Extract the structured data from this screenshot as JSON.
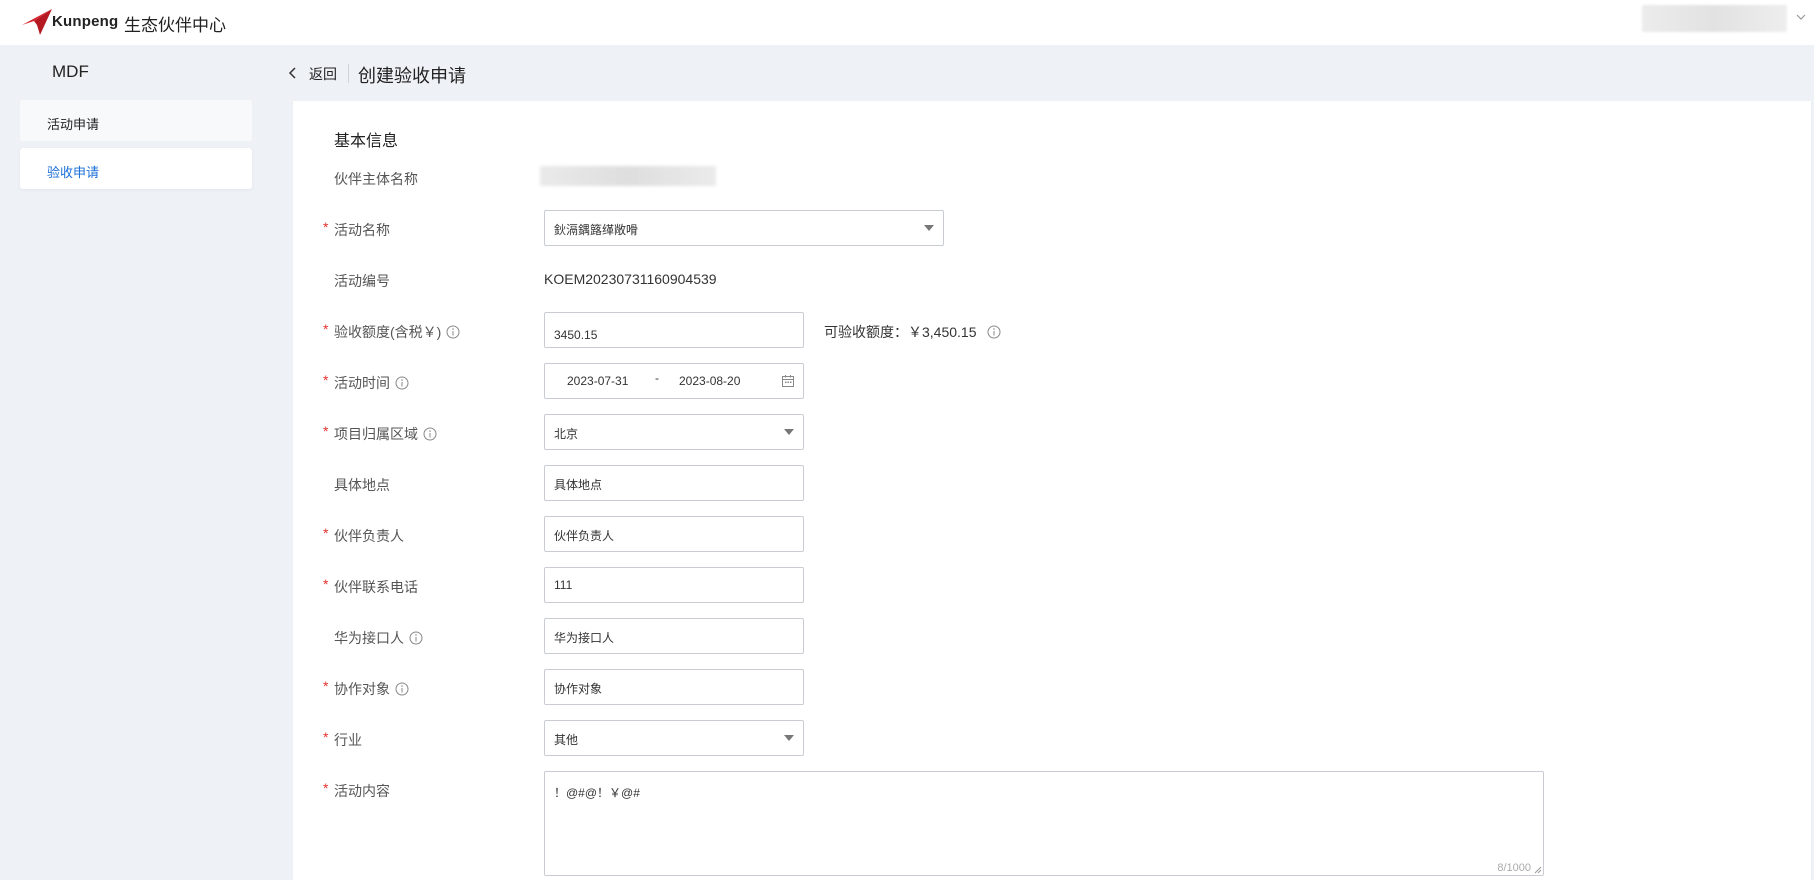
{
  "header": {
    "brand": "Kunpeng",
    "portal_title": "生态伙伴中心"
  },
  "sidebar": {
    "title": "MDF",
    "items": [
      {
        "label": "活动申请",
        "active": false
      },
      {
        "label": "验收申请",
        "active": true
      }
    ]
  },
  "breadcrumb": {
    "back_label": "返回",
    "page_title": "创建验收申请"
  },
  "form": {
    "section_title": "基本信息",
    "partner_name": {
      "label": "伙伴主体名称"
    },
    "activity_name": {
      "label": "活动名称",
      "value": "鈥滆鍝簬缂敞嗗",
      "required": true
    },
    "activity_no": {
      "label": "活动编号",
      "value": "KOEM20230731160904539"
    },
    "amount": {
      "label": "验收额度(含税￥)",
      "value": "3450.15",
      "required": true,
      "available_label": "可验收额度：￥3,450.15"
    },
    "activity_time": {
      "label": "活动时间",
      "from": "2023-07-31",
      "separator": "-",
      "to": "2023-08-20",
      "required": true
    },
    "region": {
      "label": "项目归属区域",
      "value": "北京",
      "required": true
    },
    "location": {
      "label": "具体地点",
      "value": "具体地点"
    },
    "partner_owner": {
      "label": "伙伴负责人",
      "value": "伙伴负责人",
      "required": true
    },
    "partner_phone": {
      "label": "伙伴联系电话",
      "value": "111",
      "required": true
    },
    "huawei_contact": {
      "label": "华为接口人",
      "value": "华为接口人"
    },
    "collab_target": {
      "label": "协作对象",
      "value": "协作对象",
      "required": true
    },
    "industry": {
      "label": "行业",
      "value": "其他",
      "required": true
    },
    "content": {
      "label": "活动内容",
      "value": "！@#@！￥@#",
      "counter": "8/1000",
      "required": true
    }
  },
  "colors": {
    "accent": "#1a6ed8",
    "required": "#e0312f",
    "brand_red": "#d7202a"
  },
  "icons": [
    "kunpeng-logo",
    "chevron-down-icon",
    "chevron-left-icon",
    "info-icon",
    "calendar-icon",
    "caret-down-icon",
    "resize-grip-icon"
  ]
}
